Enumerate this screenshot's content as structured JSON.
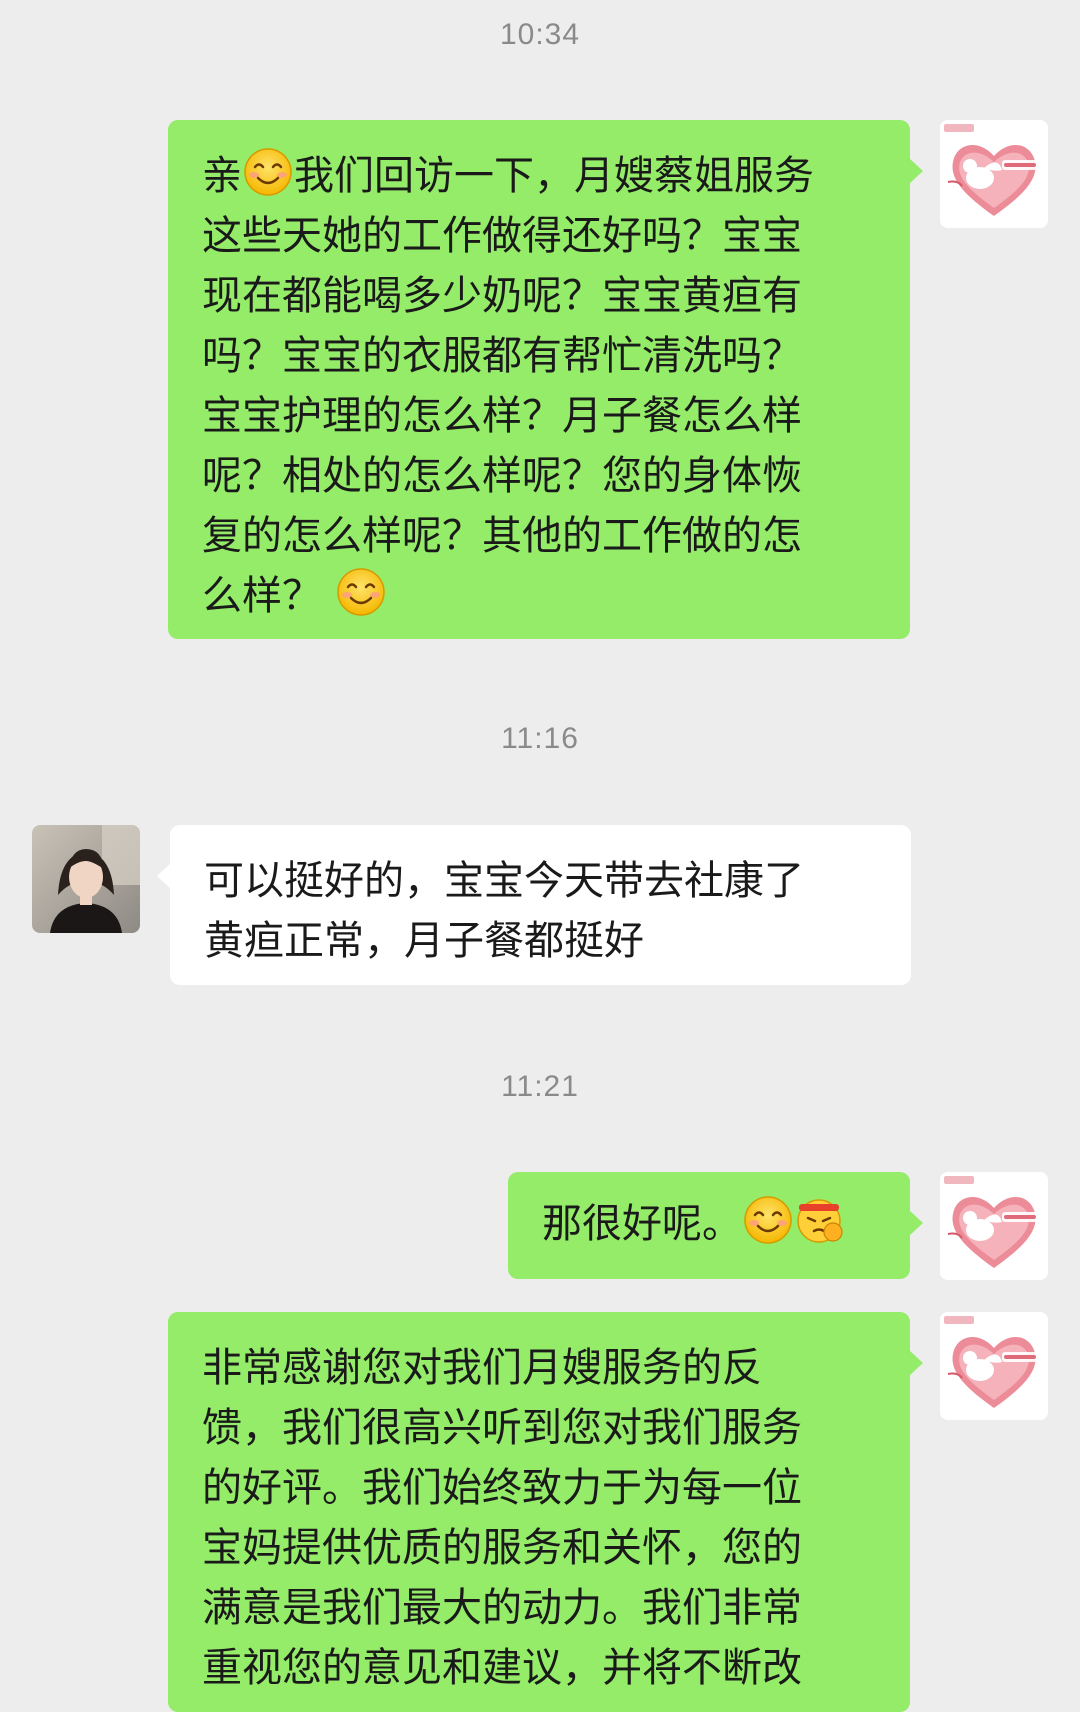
{
  "messages": [
    {
      "type": "time",
      "text": "10:34"
    },
    {
      "type": "msg",
      "side": "me",
      "segments": [
        {
          "t": "亲"
        },
        {
          "e": "smile"
        },
        {
          "t": "我们回访一下，月嫂蔡姐服务"
        },
        {
          "br": 1
        },
        {
          "t": "这些天她的工作做得还好吗？宝宝"
        },
        {
          "br": 1
        },
        {
          "t": "现在都能喝多少奶呢？宝宝黄疸有"
        },
        {
          "br": 1
        },
        {
          "t": "吗？宝宝的衣服都有帮忙清洗吗？"
        },
        {
          "br": 1
        },
        {
          "t": "宝宝护理的怎么样？月子餐怎么样"
        },
        {
          "br": 1
        },
        {
          "t": "呢？相处的怎么样呢？您的身体恢"
        },
        {
          "br": 1
        },
        {
          "t": "复的怎么样呢？其他的工作做的怎"
        },
        {
          "br": 1
        },
        {
          "t": "么样？ "
        },
        {
          "e": "smile"
        }
      ]
    },
    {
      "type": "time",
      "text": "11:16"
    },
    {
      "type": "msg",
      "side": "other",
      "segments": [
        {
          "t": "可以挺好的，宝宝今天带去社康了"
        },
        {
          "br": 1
        },
        {
          "t": "黄疸正常，月子餐都挺好"
        }
      ]
    },
    {
      "type": "time",
      "text": "11:21"
    },
    {
      "type": "msg",
      "side": "me",
      "segments": [
        {
          "t": "那很好呢。"
        },
        {
          "e": "smile"
        },
        {
          "e": "fighting"
        }
      ]
    },
    {
      "type": "msg",
      "side": "me",
      "segments": [
        {
          "t": "非常感谢您对我们月嫂服务的反"
        },
        {
          "br": 1
        },
        {
          "t": "馈，我们很高兴听到您对我们服务"
        },
        {
          "br": 1
        },
        {
          "t": "的好评。我们始终致力于为每一位"
        },
        {
          "br": 1
        },
        {
          "t": "宝妈提供优质的服务和关怀，您的"
        },
        {
          "br": 1
        },
        {
          "t": "满意是我们最大的动力。我们非常"
        },
        {
          "br": 1
        },
        {
          "t": "重视您的意见和建议，并将不断改"
        }
      ]
    }
  ],
  "icons": {
    "me_avatar": "heart-angel-logo-icon",
    "other_avatar": "user-photo-icon"
  },
  "colors": {
    "background": "#ededed",
    "me_bubble": "#95ec69",
    "other_bubble": "#ffffff",
    "time_text": "#8a8a8a"
  }
}
